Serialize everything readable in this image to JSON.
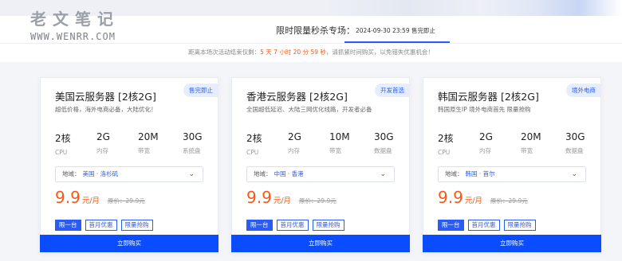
{
  "watermark": {
    "cn": "老文笔记",
    "en": "WWW.WENRR.COM"
  },
  "sale": {
    "title": "限时限量秒杀专场：",
    "tab_label": "2024-09-30 23:59 售完即止"
  },
  "countdown": {
    "prefix": "距离本场次活动结束仅剩：",
    "time": "5 天 7 小时 20 分 59 秒",
    "suffix": "，请抓紧时间购买，以免错失优惠机会！"
  },
  "colors": {
    "accent": "#2a5bf6",
    "price": "#f35a1a",
    "buy": "#0a4cff"
  },
  "icons": {
    "region_dropdown": "chevron-down-icon"
  },
  "cards": [
    {
      "badge": "售完即止",
      "name": "美国云服务器 [2核2G]",
      "desc": "超低价格，海外电商必备，大陆优化！",
      "specs": [
        {
          "value": "2核",
          "label": "CPU"
        },
        {
          "value": "2G",
          "label": "内存"
        },
        {
          "value": "20M",
          "label": "带宽"
        },
        {
          "value": "30G",
          "label": "系统盘"
        }
      ],
      "region_label": "地域：",
      "region_value": "美国 · 洛杉矶",
      "chevron": "⌄",
      "price": "9.9",
      "unit": "元/月",
      "orig": "原价：29.9元",
      "tags": [
        "限一台",
        "首月优惠",
        "限量抢购"
      ],
      "buy": "立即购买"
    },
    {
      "badge": "开发首选",
      "name": "香港云服务器 [2核2G]",
      "desc": "全国超低延迟、大陆三网优化线路，开发者必备",
      "specs": [
        {
          "value": "2核",
          "label": "CPU"
        },
        {
          "value": "2G",
          "label": "内存"
        },
        {
          "value": "10M",
          "label": "带宽"
        },
        {
          "value": "30G",
          "label": "数据盘"
        }
      ],
      "region_label": "地域：",
      "region_value": "中国 · 香港",
      "chevron": "⌄",
      "price": "9.9",
      "unit": "元/月",
      "orig": "原价：29.9元",
      "tags": [
        "限一台",
        "首月优惠",
        "限量抢购"
      ],
      "buy": "立即购买"
    },
    {
      "badge": "境外电商",
      "name": "韩国云服务器 [2核2G]",
      "desc": "韩国原生IP 境外电商首先 限量抢购",
      "specs": [
        {
          "value": "2核",
          "label": "CPU"
        },
        {
          "value": "2G",
          "label": "内存"
        },
        {
          "value": "20M",
          "label": "带宽"
        },
        {
          "value": "30G",
          "label": "数据盘"
        }
      ],
      "region_label": "地域：",
      "region_value": "韩国 · 首尔",
      "chevron": "⌄",
      "price": "9.9",
      "unit": "元/月",
      "orig": "原价：29.9元",
      "tags": [
        "限一台",
        "首月优惠",
        "限量抢购"
      ],
      "buy": "立即购买"
    }
  ]
}
